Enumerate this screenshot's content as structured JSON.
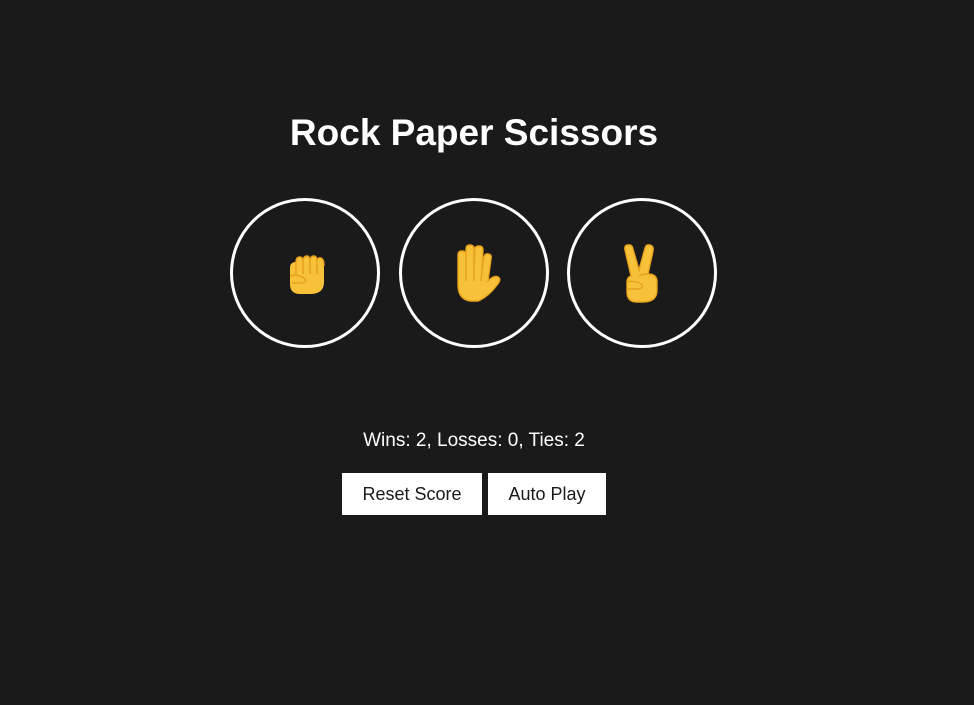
{
  "title": "Rock Paper Scissors",
  "moves": [
    {
      "name": "rock",
      "icon": "fist-icon"
    },
    {
      "name": "paper",
      "icon": "raised-hand-icon"
    },
    {
      "name": "scissors",
      "icon": "victory-hand-icon"
    }
  ],
  "score": {
    "text": "Wins: 2, Losses: 0, Ties: 2"
  },
  "buttons": {
    "reset_label": "Reset Score",
    "auto_play_label": "Auto Play"
  },
  "colors": {
    "background": "#1a1a1a",
    "text": "#ffffff",
    "emoji_skin": "#f7c13a",
    "emoji_shade": "#e8a21c"
  }
}
